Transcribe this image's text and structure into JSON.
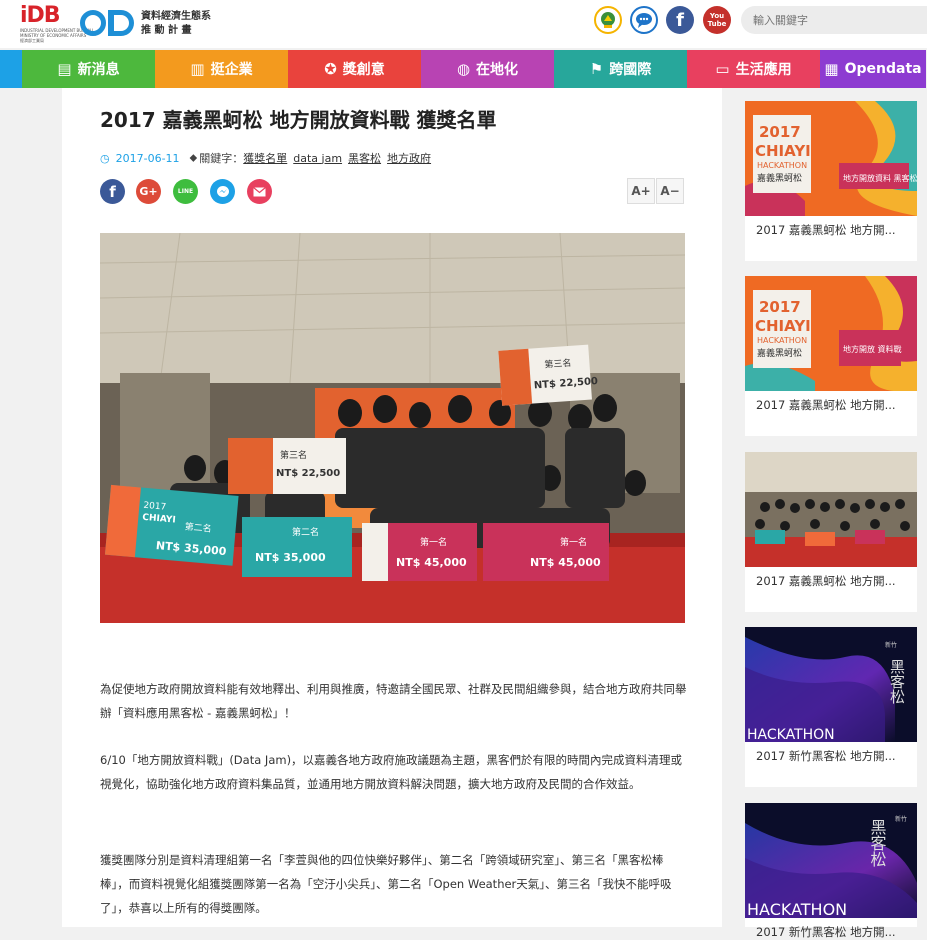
{
  "header": {
    "logo_idb": {
      "main": "iDB",
      "sub1": "INDUSTRIAL DEVELOPMENT BUREAU",
      "sub2": "MINISTRY OF ECONOMIC AFFAIRS",
      "sub3": "經濟部工業局"
    },
    "logo_od_line1": "資料經濟生態系",
    "logo_od_line2": "推 動 計 畫",
    "social": [
      {
        "name": "award",
        "label": "",
        "color": "#3a8f3a"
      },
      {
        "name": "chat",
        "label": "",
        "color": "#1e74c9"
      },
      {
        "name": "facebook",
        "label": "f",
        "color": "#3b5998"
      },
      {
        "name": "youtube",
        "label": "You Tube",
        "color": "#c4302b"
      }
    ],
    "search_placeholder": "輸入關鍵字"
  },
  "nav": [
    {
      "label": "新消息",
      "icon": "newspaper-icon",
      "glyph": "▤",
      "color": "#4db83d"
    },
    {
      "label": "挺企業",
      "icon": "building-icon",
      "glyph": "▥",
      "color": "#f39a1e"
    },
    {
      "label": "獎創意",
      "icon": "medal-icon",
      "glyph": "✪",
      "color": "#e9433d"
    },
    {
      "label": "在地化",
      "icon": "globe-icon",
      "glyph": "◍",
      "color": "#b843b3"
    },
    {
      "label": "跨國際",
      "icon": "location-icon",
      "glyph": "⚑",
      "color": "#27a79b"
    },
    {
      "label": "生活應用",
      "icon": "monitor-icon",
      "glyph": "▭",
      "color": "#e8405f"
    },
    {
      "label": "Opendata",
      "icon": "chart-icon",
      "glyph": "▦",
      "color": "#8d3bd1"
    }
  ],
  "article": {
    "title": "2017 嘉義黑蚵松 地方開放資料戰 獲獎名單",
    "date": "2017-06-11",
    "keywords_label": "關鍵字：",
    "tags": [
      "獲獎名單",
      "data jam",
      "黑客松",
      "地方政府"
    ],
    "share": [
      {
        "name": "facebook",
        "label": "f",
        "color": "#3b5998"
      },
      {
        "name": "google-plus",
        "label": "G+",
        "color": "#dd4b39"
      },
      {
        "name": "line",
        "label": "LINE",
        "color": "#3ebd3e"
      },
      {
        "name": "messenger",
        "label": "✉",
        "color": "#1da1e6"
      },
      {
        "name": "email",
        "label": "✉",
        "color": "#e8405f"
      }
    ],
    "font_larger": "A+",
    "font_smaller": "A−",
    "photo": {
      "banner_third": "第三名",
      "prize_third": "NT$ 22,500",
      "prize_second": "NT$ 35,000",
      "prize_first": "NT$ 45,000",
      "second": "第二名",
      "first": "第一名",
      "event_year": "2017",
      "event_city": "CHIAYI"
    },
    "paragraphs": [
      "為促使地方政府開放資料能有效地釋出、利用與推廣，特邀請全國民眾、社群及民間組織參與，結合地方政府共同舉辦「資料應用黑客松 - 嘉義黑蚵松」！",
      "6/10「地方開放資料戰」(Data Jam)，以嘉義各地方政府施政議題為主題，黑客們於有限的時間內完成資料清理或視覺化，協助強化地方政府資料集品質，並通用地方開放資料解決問題，擴大地方政府及民間的合作效益。",
      "獲獎團隊分別是資料清理組第一名「李萱與他的四位快樂好夥伴」、第二名「跨領域研究室」、第三名「黑客松棒棒」，而資料視覺化組獲獎團隊第一名為「空汙小尖兵」、第二名「Open Weather天氣」、第三名「我快不能呼吸了」，恭喜以上所有的得獎團隊。"
    ]
  },
  "sidebar": [
    {
      "caption": "2017 嘉義黑蚵松 地方開...",
      "thumb": {
        "year": "2017",
        "city": "CHIAYI",
        "hack": "HACKATHON",
        "zh": "嘉義黑蚵松",
        "box": "地方開放資料 黑客松"
      }
    },
    {
      "caption": "2017 嘉義黑蚵松 地方開...",
      "thumb": {
        "year": "2017",
        "city": "CHIAYI",
        "hack": "HACKATHON",
        "zh": "嘉義黑蚵松",
        "box": "地方開放 資料戰"
      }
    },
    {
      "caption": "2017 嘉義黑蚵松 地方開...",
      "thumb": {}
    },
    {
      "caption": "2017 新竹黑客松 地方開...",
      "thumb": {
        "zh": "黑客松",
        "city": "新竹",
        "hack": "HACKATHON"
      }
    },
    {
      "caption": "2017 新竹黑客松 地方開...",
      "thumb": {
        "zh": "黑客松",
        "city": "新竹",
        "hack": "HACKATHON"
      }
    }
  ]
}
